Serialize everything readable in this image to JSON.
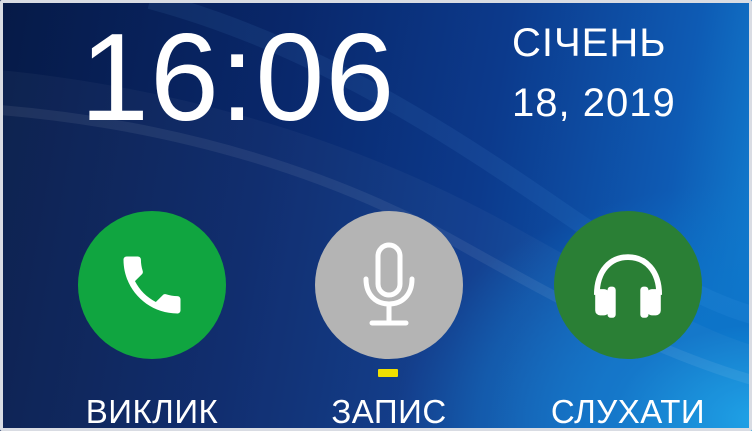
{
  "clock": {
    "time": "16:06"
  },
  "calendar": {
    "month": "СІЧЕНЬ",
    "date": "18, 2019"
  },
  "actions": [
    {
      "label": "ВИКЛИК",
      "icon": "phone-icon",
      "color": "#10a540"
    },
    {
      "label": "ЗАПИС",
      "icon": "microphone-icon",
      "color": "#b4b4b4",
      "selected": true
    },
    {
      "label": "СЛУХАТИ",
      "icon": "headphones-icon",
      "color": "#2a7f35"
    }
  ],
  "colors": {
    "selection_indicator": "#f1e000",
    "text": "#ffffff",
    "background_dark": "#061a47",
    "background_light": "#17a0e6"
  }
}
